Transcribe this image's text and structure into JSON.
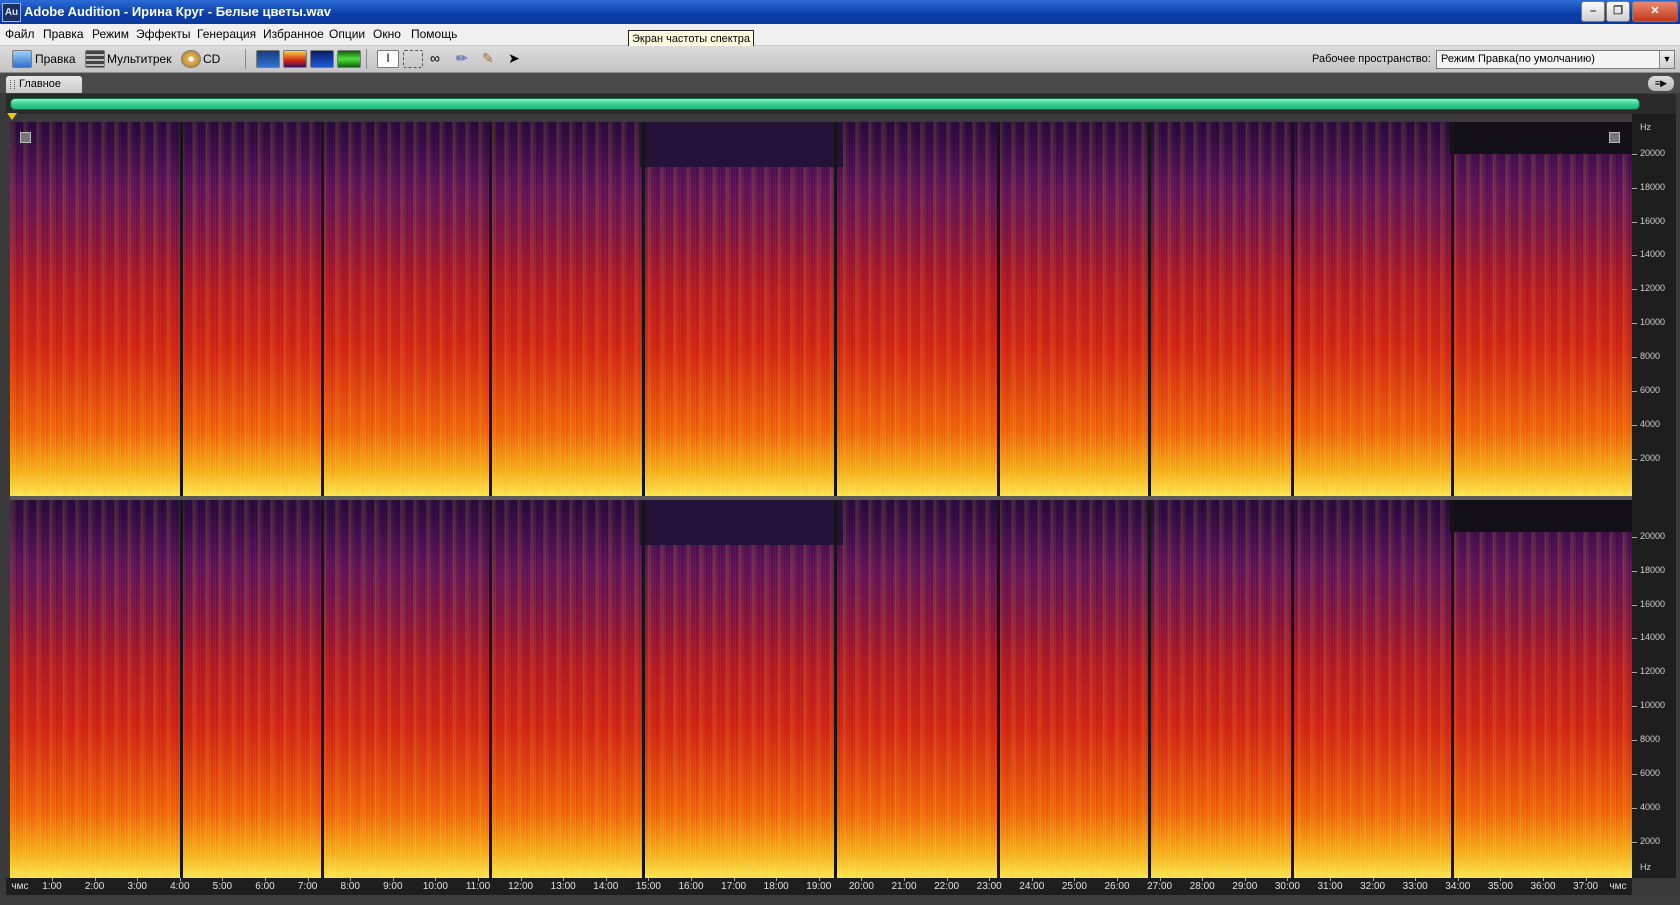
{
  "window": {
    "title": "Adobe Audition - Ирина Круг - Белые цветы.wav",
    "app_icon_text": "Au"
  },
  "menu": [
    "Файл",
    "Правка",
    "Режим",
    "Эффекты",
    "Генерация",
    "Избранное",
    "Опции",
    "Окно",
    "Помощь"
  ],
  "tooltip": "Экран частоты спектра",
  "toolbar": {
    "edit_label": "Правка",
    "multitrack_label": "Мультитрек",
    "cd_label": "CD",
    "workspace_label": "Рабочее пространство:",
    "workspace_value": "Режим Правка(по умолчанию)"
  },
  "panel": {
    "tab_label": "Главное"
  },
  "freq_axis": {
    "unit": "Hz",
    "labels_ch1": [
      "20000",
      "18000",
      "16000",
      "14000",
      "12000",
      "10000",
      "8000",
      "6000",
      "4000",
      "2000"
    ],
    "labels_ch2": [
      "20000",
      "18000",
      "16000",
      "14000",
      "12000",
      "10000",
      "8000",
      "6000",
      "4000",
      "2000",
      "Hz"
    ]
  },
  "time_axis": {
    "start_label": "чмс",
    "end_label": "чмс",
    "labels": [
      "1:00",
      "2:00",
      "3:00",
      "4:00",
      "5:00",
      "6:00",
      "7:00",
      "8:00",
      "9:00",
      "10:00",
      "11:00",
      "12:00",
      "13:00",
      "14:00",
      "15:00",
      "16:00",
      "17:00",
      "18:00",
      "19:00",
      "20:00",
      "21:00",
      "22:00",
      "23:00",
      "24:00",
      "25:00",
      "26:00",
      "27:00",
      "28:00",
      "29:00",
      "30:00",
      "31:00",
      "32:00",
      "33:00",
      "34:00",
      "35:00",
      "36:00",
      "37:00"
    ]
  },
  "colors": {
    "overview_bar": "#36d08e",
    "spectrum_low": "#fde85a",
    "spectrum_mid": "#d72a14",
    "spectrum_high": "#3b0f5c"
  }
}
